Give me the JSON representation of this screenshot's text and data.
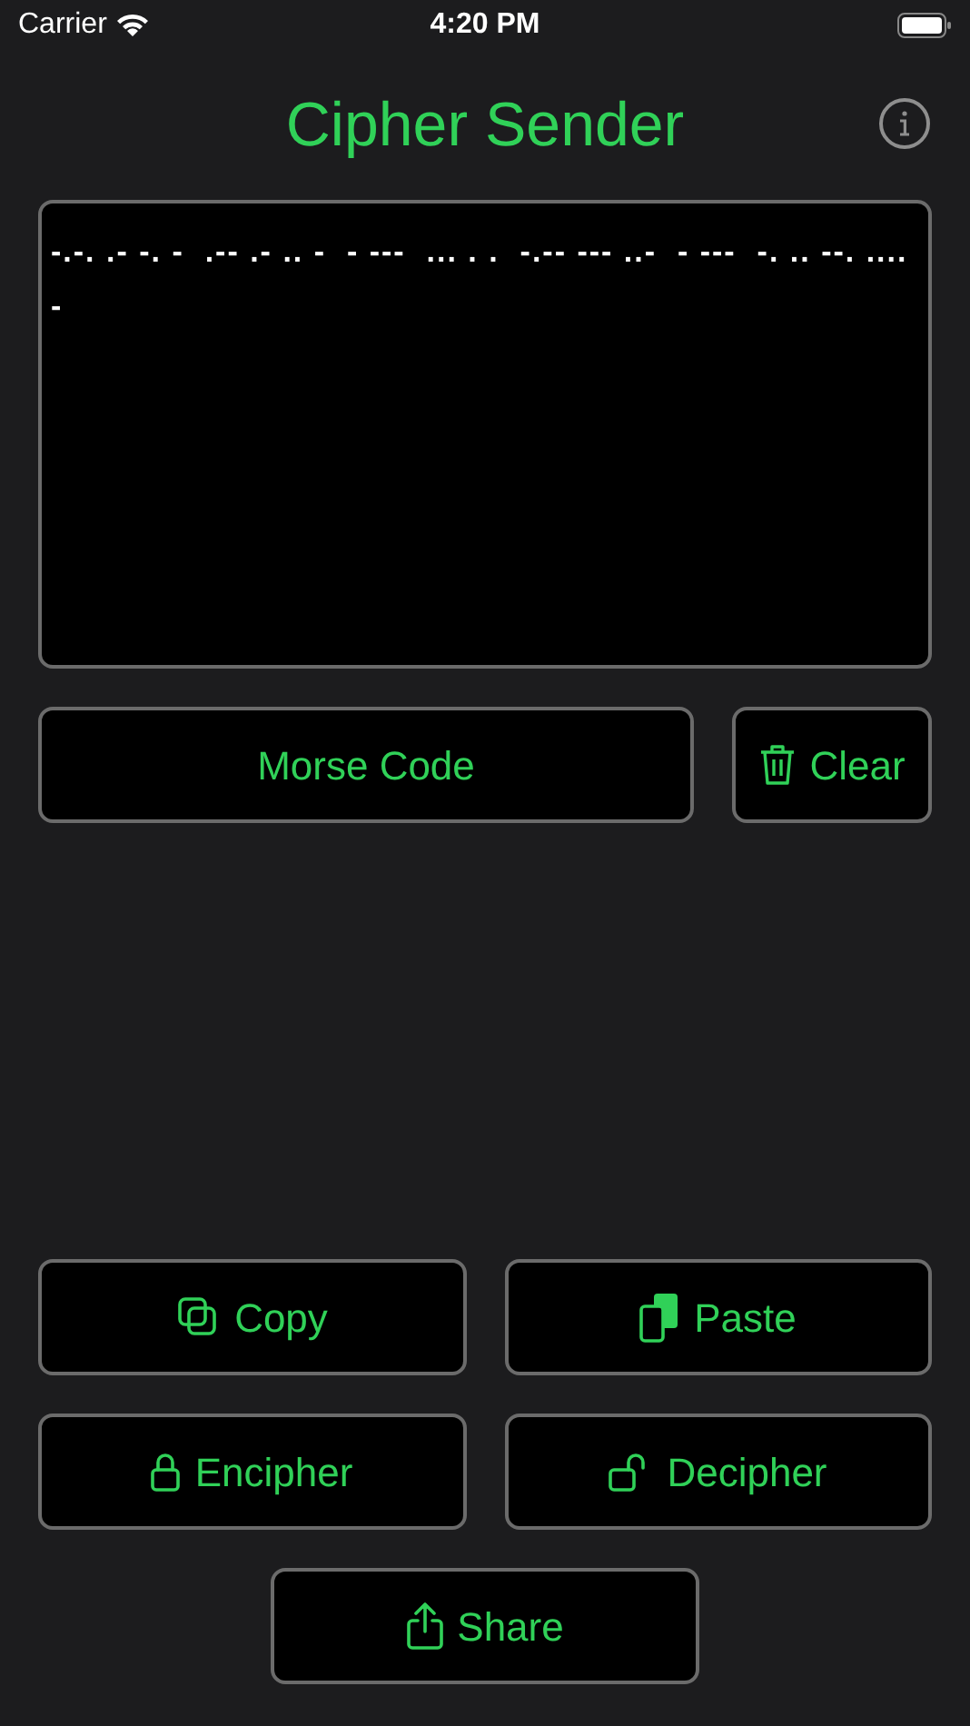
{
  "status_bar": {
    "carrier": "Carrier",
    "time": "4:20 PM"
  },
  "title": "Cipher Sender",
  "message": "-.-. .- -. -  .-- .- .. -  - ---  ... . .  -.-- --- ..-  - ---  -. .. --. .... -",
  "mode_button": {
    "label": "Morse Code"
  },
  "clear_button": {
    "label": "Clear"
  },
  "actions": [
    {
      "kind": "copy",
      "label": "Copy"
    },
    {
      "kind": "paste",
      "label": "Paste"
    },
    {
      "kind": "encipher",
      "label": "Encipher"
    },
    {
      "kind": "decipher",
      "label": "Decipher"
    },
    {
      "kind": "share",
      "label": "Share"
    }
  ]
}
